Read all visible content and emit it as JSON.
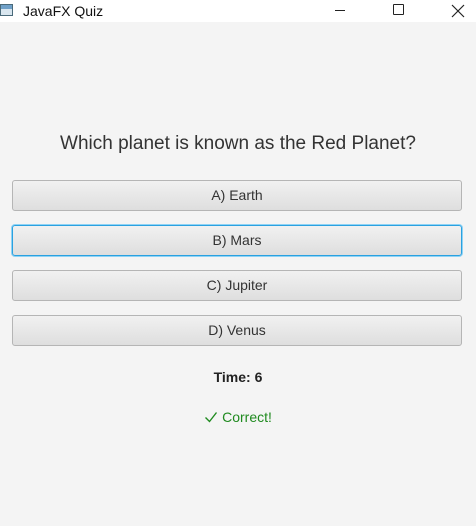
{
  "window": {
    "title": "JavaFX Quiz",
    "icon": "app-window-icon",
    "controls": [
      "minimize-icon",
      "maximize-icon",
      "close-icon"
    ]
  },
  "quiz": {
    "question": "Which planet is known as the Red Planet?",
    "answers": [
      {
        "label": "A) Earth",
        "focused": false
      },
      {
        "label": "B) Mars",
        "focused": true
      },
      {
        "label": "C) Jupiter",
        "focused": false
      },
      {
        "label": "D) Venus",
        "focused": false
      }
    ],
    "timer_label": "Time: 6",
    "feedback": {
      "text": "Correct!",
      "icon": "check-icon",
      "color": "#1f8a1f"
    }
  },
  "colors": {
    "background": "#f4f4f4",
    "focus_ring": "#2aa1e0"
  }
}
